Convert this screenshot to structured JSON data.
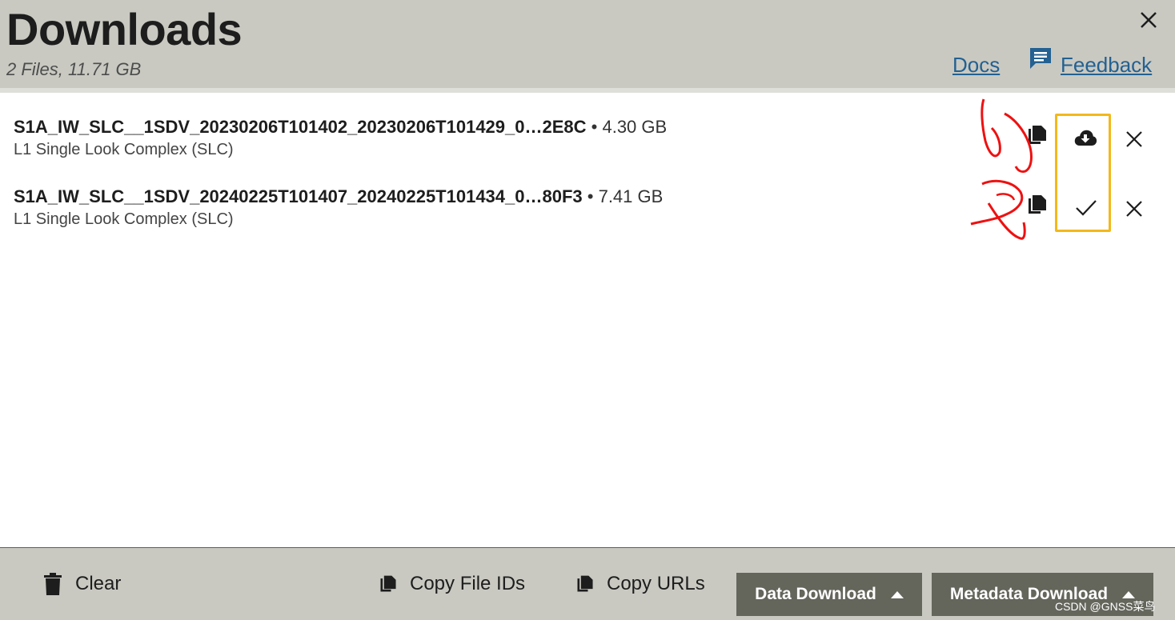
{
  "header": {
    "title": "Downloads",
    "subtitle": "2 Files, 11.71 GB",
    "docs_label": "Docs",
    "feedback_label": "Feedback",
    "close_icon": "close-icon",
    "feedback_icon": "comment-icon"
  },
  "files": [
    {
      "name": "S1A_IW_SLC__1SDV_20230206T101402_20230206T101429_0…2E8C",
      "size": "• 4.30 GB",
      "type": "L1 Single Look Complex (SLC)",
      "status": "download",
      "status_icon": "cloud-download-icon"
    },
    {
      "name": "S1A_IW_SLC__1SDV_20240225T101407_20240225T101434_0…80F3",
      "size": "• 7.41 GB",
      "type": "L1 Single Look Complex (SLC)",
      "status": "downloaded",
      "status_icon": "check-icon"
    }
  ],
  "footer": {
    "clear_label": "Clear",
    "copy_ids_label": "Copy File IDs",
    "copy_urls_label": "Copy URLs",
    "data_download_label": "Data Download",
    "metadata_download_label": "Metadata Download"
  },
  "watermark": "CSDN @GNSS菜鸟",
  "colors": {
    "header_bg": "#c9c9c2",
    "link": "#236192",
    "highlight": "#f3b81a",
    "annotation": "#ee1111",
    "dark_button": "#64665c"
  }
}
